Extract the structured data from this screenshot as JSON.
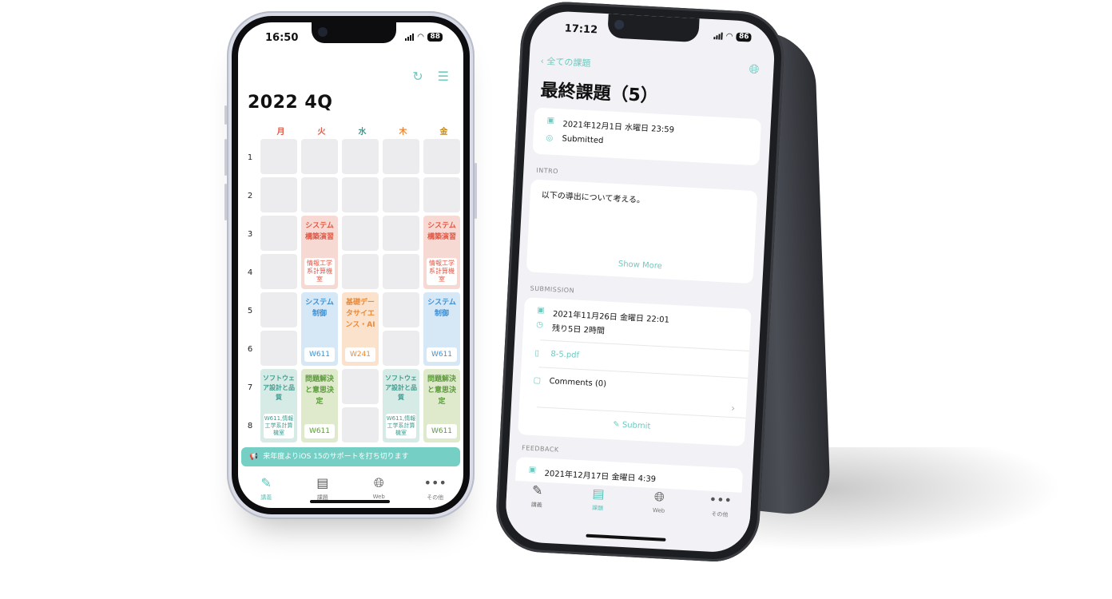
{
  "colors": {
    "accent": "#6fcac0",
    "red": "#e05a48",
    "blue": "#3f8fd1",
    "orange": "#ea8a3a",
    "green": "#5b9a3a",
    "teal": "#3c9b8f"
  },
  "left_phone": {
    "status": {
      "time": "16:50",
      "battery": "88"
    },
    "top_icons": [
      "refresh-icon",
      "list-icon"
    ],
    "page_title": "2022 4Q",
    "days": [
      "月",
      "火",
      "水",
      "木",
      "金"
    ],
    "periods": [
      "1",
      "2",
      "3",
      "4",
      "5",
      "6",
      "7",
      "8"
    ],
    "classes": {
      "c1": {
        "name": "システム構築演習",
        "room": "情報工学系計算機室"
      },
      "c2": {
        "name": "システム構築演習",
        "room": "情報工学系計算機室"
      },
      "c3": {
        "name": "システム制御",
        "room": "W611"
      },
      "c4": {
        "name": "基礎データサイエンス・AI",
        "room": "W241"
      },
      "c5": {
        "name": "システム制御",
        "room": "W611"
      },
      "c6": {
        "name": "ソフトウェア設計と品質",
        "room": "W611,情報工学系計算機室"
      },
      "c7": {
        "name": "問題解決と意思決定",
        "room": "W611"
      },
      "c8": {
        "name": "ソフトウェア設計と品質",
        "room": "W611,情報工学系計算機室"
      },
      "c9": {
        "name": "問題解決と意思決定",
        "room": "W611"
      }
    },
    "banner": "来年度よりiOS 15のサポートを打ち切ります",
    "tabs": [
      {
        "label": "講義",
        "icon": "pencil-icon"
      },
      {
        "label": "課題",
        "icon": "list-doc-icon"
      },
      {
        "label": "Web",
        "icon": "globe-icon"
      },
      {
        "label": "その他",
        "icon": "more-icon"
      }
    ]
  },
  "right_phone": {
    "status": {
      "time": "17:12",
      "battery": "86"
    },
    "back_label": "全ての課題",
    "title": "最終課題（5）",
    "deadline": "2021年12月1日 水曜日 23:59",
    "status_text": "Submitted",
    "intro_label": "INTRO",
    "intro_text": "以下の導出について考える。",
    "show_more": "Show More",
    "submission_label": "SUBMISSION",
    "submitted_at": "2021年11月26日 金曜日 22:01",
    "remaining": "残り5日 2時間",
    "file": "8-5.pdf",
    "comments": "Comments (0)",
    "submit": "Submit",
    "feedback_label": "FEEDBACK",
    "feedback_date": "2021年12月17日 金曜日 4:39",
    "tabs": [
      {
        "label": "講義",
        "icon": "pencil-icon"
      },
      {
        "label": "課題",
        "icon": "list-doc-icon"
      },
      {
        "label": "Web",
        "icon": "globe-icon"
      },
      {
        "label": "その他",
        "icon": "more-icon"
      }
    ]
  }
}
